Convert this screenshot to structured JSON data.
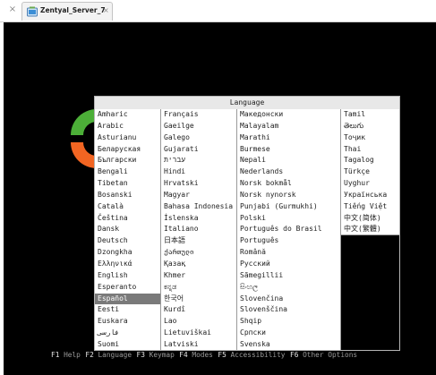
{
  "window": {
    "vm_tab_label": "Zentyal_Server_7",
    "close_glyph": "×"
  },
  "dialog": {
    "title": "Language",
    "selected": "Español",
    "columns": [
      [
        "Amharic",
        "Arabic",
        "Asturianu",
        "Беларуская",
        "Български",
        "Bengali",
        "Tibetan",
        "Bosanski",
        "Català",
        "Čeština",
        "Dansk",
        "Deutsch",
        "Dzongkha",
        "Ελληνικά",
        "English",
        "Esperanto",
        "Español",
        "Eesti",
        "Euskara",
        "فارسی",
        "Suomi"
      ],
      [
        "Français",
        "Gaeilge",
        "Galego",
        "Gujarati",
        "עברית",
        "Hindi",
        "Hrvatski",
        "Magyar",
        "Bahasa Indonesia",
        "Íslenska",
        "Italiano",
        "日本語",
        "ქართული",
        "Қазақ",
        "Khmer",
        "ಕನ್ನಡ",
        "한국어",
        "Kurdî",
        "Lao",
        "Lietuviškai",
        "Latviski"
      ],
      [
        "Македонски",
        "Malayalam",
        "Marathi",
        "Burmese",
        "Nepali",
        "Nederlands",
        "Norsk bokmål",
        "Norsk nynorsk",
        "Punjabi (Gurmukhi)",
        "Polski",
        "Português do Brasil",
        "Português",
        "Română",
        "Русский",
        "Sãmegillii",
        "සිංහල",
        "Slovenčina",
        "Slovenščina",
        "Shqip",
        "Српски",
        "Svenska"
      ],
      [
        "Tamil",
        "తెలుగు",
        "Тоҷик",
        "Thai",
        "Tagalog",
        "Türkçe",
        "Uyghur",
        "Українська",
        "Tiếng Việt",
        "中文(简体)",
        "中文(繁體)"
      ]
    ]
  },
  "function_keys": [
    {
      "key": "F1",
      "label": "Help"
    },
    {
      "key": "F2",
      "label": "Language"
    },
    {
      "key": "F3",
      "label": "Keymap"
    },
    {
      "key": "F4",
      "label": "Modes"
    },
    {
      "key": "F5",
      "label": "Accessibility"
    },
    {
      "key": "F6",
      "label": "Other Options"
    }
  ],
  "colors": {
    "screen_bg": "#000000",
    "logo_green": "#4caf38",
    "logo_orange": "#f26522",
    "selection_bg": "#7a7a7a"
  }
}
